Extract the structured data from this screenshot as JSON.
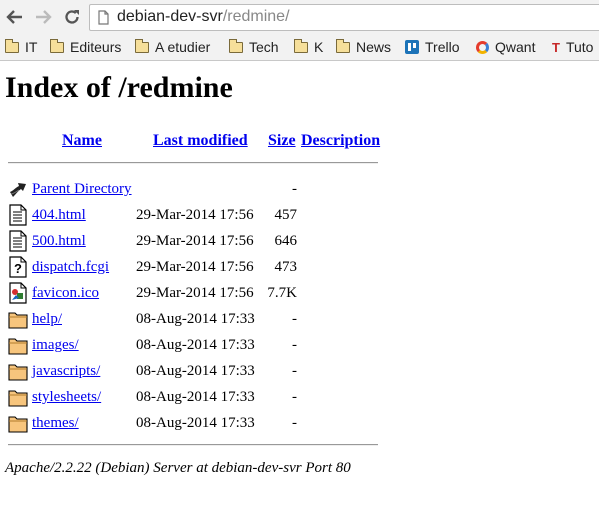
{
  "browser": {
    "url_host": "debian-dev-svr",
    "url_path": "/redmine/",
    "bookmarks": [
      "IT",
      "Editeurs",
      "A etudier",
      "Tech",
      "K",
      "News",
      "Trello",
      "Qwant",
      "Tuto"
    ]
  },
  "page": {
    "title": "Index of /redmine",
    "columns": {
      "name": "Name",
      "last_modified": "Last modified",
      "size": "Size",
      "description": "Description"
    },
    "entries": [
      {
        "icon": "back-icon",
        "name": "Parent Directory",
        "modified": "",
        "size": "-"
      },
      {
        "icon": "text-file-icon",
        "name": "404.html",
        "modified": "29-Mar-2014 17:56",
        "size": "457"
      },
      {
        "icon": "text-file-icon",
        "name": "500.html",
        "modified": "29-Mar-2014 17:56",
        "size": "646"
      },
      {
        "icon": "unknown-file-icon",
        "name": "dispatch.fcgi",
        "modified": "29-Mar-2014 17:56",
        "size": "473"
      },
      {
        "icon": "image-file-icon",
        "name": "favicon.ico",
        "modified": "29-Mar-2014 17:56",
        "size": "7.7K"
      },
      {
        "icon": "folder-icon",
        "name": "help/",
        "modified": "08-Aug-2014 17:33",
        "size": "-"
      },
      {
        "icon": "folder-icon",
        "name": "images/",
        "modified": "08-Aug-2014 17:33",
        "size": "-"
      },
      {
        "icon": "folder-icon",
        "name": "javascripts/",
        "modified": "08-Aug-2014 17:33",
        "size": "-"
      },
      {
        "icon": "folder-icon",
        "name": "stylesheets/",
        "modified": "08-Aug-2014 17:33",
        "size": "-"
      },
      {
        "icon": "folder-icon",
        "name": "themes/",
        "modified": "08-Aug-2014 17:33",
        "size": "-"
      }
    ],
    "footer": "Apache/2.2.22 (Debian) Server at debian-dev-svr Port 80"
  }
}
